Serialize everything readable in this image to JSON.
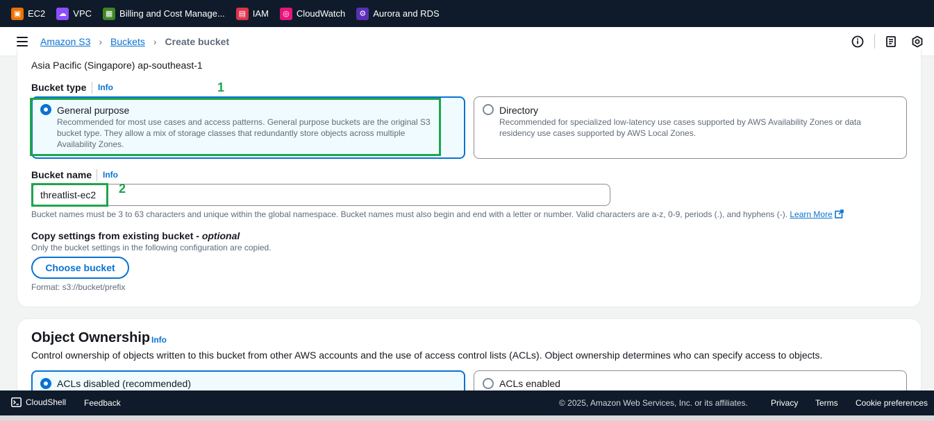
{
  "favorites": [
    {
      "label": "EC2",
      "icon": "ec2-icon",
      "color": "#ed7100"
    },
    {
      "label": "VPC",
      "icon": "vpc-icon",
      "color": "#8c4fff"
    },
    {
      "label": "Billing and Cost Manage...",
      "icon": "billing-icon",
      "color": "#3f8624"
    },
    {
      "label": "IAM",
      "icon": "iam-icon",
      "color": "#dd344c"
    },
    {
      "label": "CloudWatch",
      "icon": "cloudwatch-icon",
      "color": "#e7157b"
    },
    {
      "label": "Aurora and RDS",
      "icon": "rds-icon",
      "color": "#5a30b5"
    }
  ],
  "breadcrumb": {
    "items": [
      "Amazon S3",
      "Buckets"
    ],
    "current": "Create bucket"
  },
  "general": {
    "region": "Asia Pacific (Singapore) ap-southeast-1",
    "bucket_type_label": "Bucket type",
    "info": "Info",
    "options": [
      {
        "title": "General purpose",
        "desc_lines": [
          "Recommended for most use cases and access patterns. General purpose buckets are the original S3",
          "bucket type. They allow a mix of storage classes that redundantly store objects across multiple",
          "Availability Zones."
        ],
        "selected": true
      },
      {
        "title": "Directory",
        "desc_lines": [
          "Recommended for specialized low-latency use cases supported by AWS Availability Zones or data",
          "residency use cases supported by AWS Local Zones."
        ],
        "selected": false
      }
    ],
    "bucket_name_label": "Bucket name",
    "bucket_name_value": "threatlist-ec2",
    "bucket_name_hint": "Bucket names must be 3 to 63 characters and unique within the global namespace. Bucket names must also begin and end with a letter or number. Valid characters are a-z, 0-9, periods (.), and hyphens (-).",
    "learn_more": "Learn More",
    "copy_label": "Copy settings from existing bucket - ",
    "copy_optional": "optional",
    "copy_desc": "Only the bucket settings in the following configuration are copied.",
    "choose_bucket": "Choose bucket",
    "format": "Format: s3://bucket/prefix"
  },
  "annotations": [
    "1",
    "2"
  ],
  "ownership": {
    "title": "Object Ownership",
    "info": "Info",
    "desc": "Control ownership of objects written to this bucket from other AWS accounts and the use of access control lists (ACLs). Object ownership determines who can specify access to objects.",
    "options": [
      {
        "title": "ACLs disabled (recommended)",
        "selected": true
      },
      {
        "title": "ACLs enabled",
        "selected": false
      }
    ]
  },
  "footer": {
    "cloudshell": "CloudShell",
    "feedback": "Feedback",
    "copyright": "© 2025, Amazon Web Services, Inc. or its affiliates.",
    "privacy": "Privacy",
    "terms": "Terms",
    "cookie": "Cookie preferences"
  }
}
